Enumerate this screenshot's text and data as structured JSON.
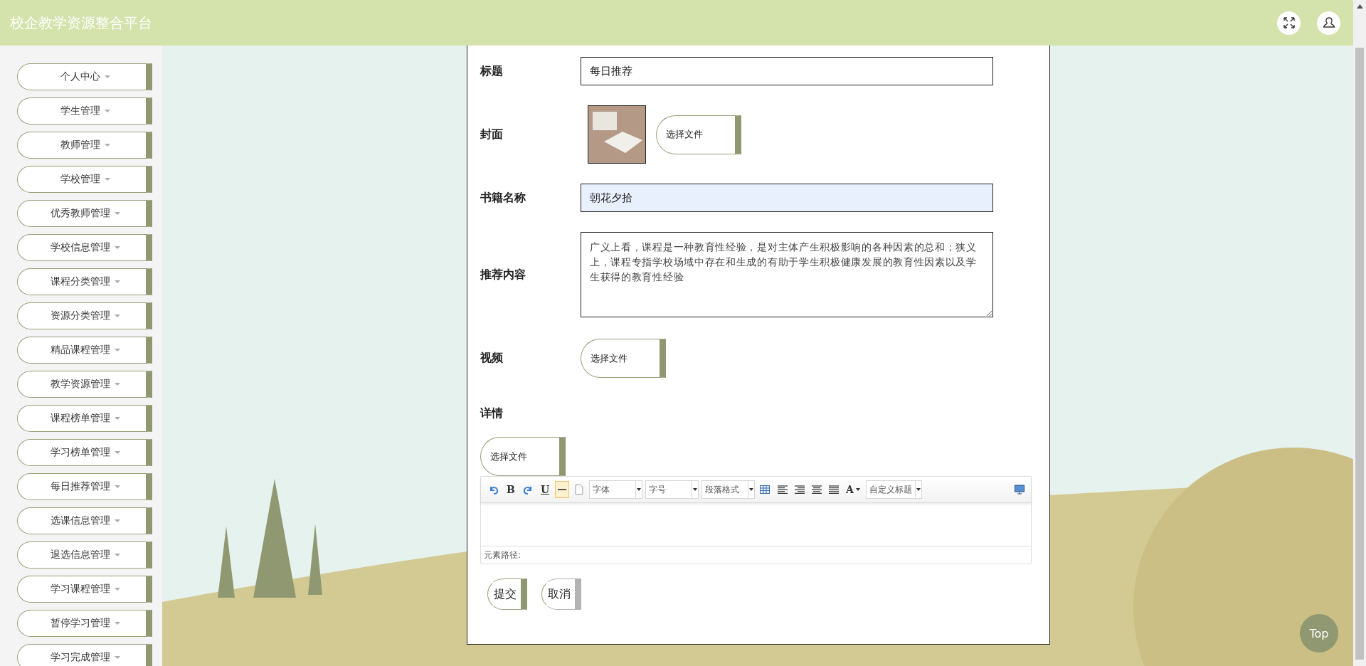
{
  "header": {
    "title": "校企教学资源整合平台"
  },
  "sidebar": {
    "items": [
      {
        "label": "个人中心"
      },
      {
        "label": "学生管理"
      },
      {
        "label": "教师管理"
      },
      {
        "label": "学校管理"
      },
      {
        "label": "优秀教师管理"
      },
      {
        "label": "学校信息管理"
      },
      {
        "label": "课程分类管理"
      },
      {
        "label": "资源分类管理"
      },
      {
        "label": "精品课程管理"
      },
      {
        "label": "教学资源管理"
      },
      {
        "label": "课程榜单管理"
      },
      {
        "label": "学习榜单管理"
      },
      {
        "label": "每日推荐管理"
      },
      {
        "label": "选课信息管理"
      },
      {
        "label": "退选信息管理"
      },
      {
        "label": "学习课程管理"
      },
      {
        "label": "暂停学习管理"
      },
      {
        "label": "学习完成管理"
      }
    ]
  },
  "form": {
    "fields": [
      {
        "kind": "text",
        "label": "标题",
        "value": "每日推荐",
        "autofilled": false
      },
      {
        "kind": "image",
        "label": "封面",
        "button": "选择文件"
      },
      {
        "kind": "text",
        "label": "书籍名称",
        "value": "朝花夕拾",
        "autofilled": true
      },
      {
        "kind": "textarea",
        "label": "推荐内容",
        "value": "广义上看，课程是一种教育性经验，是对主体产生积极影响的各种因素的总和；狭义上，课程专指学校场域中存在和生成的有助于学生积极健康发展的教育性因素以及学生获得的教育性经验"
      },
      {
        "kind": "file",
        "label": "视频",
        "button": "选择文件"
      },
      {
        "kind": "editor",
        "label": "详情",
        "button": "选择文件"
      }
    ]
  },
  "editor": {
    "toolbar": [
      {
        "kind": "undo",
        "hovered": false
      },
      {
        "kind": "bold",
        "text": "B",
        "hovered": false
      },
      {
        "kind": "redo",
        "hovered": false
      },
      {
        "kind": "underline",
        "text": "U",
        "hovered": false
      },
      {
        "kind": "rule",
        "hovered": true
      },
      {
        "kind": "page",
        "hovered": false
      },
      {
        "kind": "select",
        "text": "字体",
        "hovered": false
      },
      {
        "kind": "select",
        "text": "字号",
        "hovered": false
      },
      {
        "kind": "select",
        "text": "段落格式",
        "hovered": false
      },
      {
        "kind": "table",
        "hovered": false
      },
      {
        "kind": "align-left",
        "hovered": false
      },
      {
        "kind": "align-right",
        "hovered": false
      },
      {
        "kind": "align-center",
        "hovered": false
      },
      {
        "kind": "justify",
        "hovered": false
      },
      {
        "kind": "font-color",
        "text": "A",
        "hovered": false
      },
      {
        "kind": "select",
        "text": "自定义标题",
        "hovered": false
      },
      {
        "kind": "preview",
        "hovered": false
      }
    ],
    "path_label": "元素路径:"
  },
  "actions": [
    {
      "kind": "primary",
      "label": "提交"
    },
    {
      "kind": "secondary",
      "label": "取消"
    }
  ],
  "back_to_top": "Top"
}
